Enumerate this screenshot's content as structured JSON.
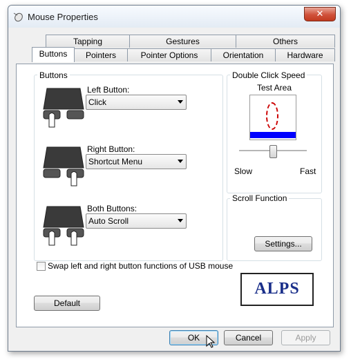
{
  "window": {
    "title": "Mouse Properties",
    "close_label": "✕"
  },
  "tabs_row1": [
    "Tapping",
    "Gestures",
    "Others"
  ],
  "tabs_row2": [
    "Buttons",
    "Pointers",
    "Pointer Options",
    "Orientation",
    "Hardware"
  ],
  "active_tab": "Buttons",
  "buttons_group": {
    "label": "Buttons",
    "left": {
      "label": "Left Button:",
      "value": "Click"
    },
    "right": {
      "label": "Right Button:",
      "value": "Shortcut Menu"
    },
    "both": {
      "label": "Both Buttons:",
      "value": "Auto Scroll"
    }
  },
  "double_click": {
    "label": "Double Click Speed",
    "test_area": "Test Area",
    "slow": "Slow",
    "fast": "Fast",
    "speed_level": 0.5
  },
  "scroll": {
    "label": "Scroll Function",
    "settings_label": "Settings..."
  },
  "swap": {
    "label": "Swap left and right button functions of USB mouse",
    "checked": false
  },
  "default_label": "Default",
  "logo_text": "ALPS",
  "footer": {
    "ok": "OK",
    "cancel": "Cancel",
    "apply": "Apply"
  },
  "colors": {
    "logo_blue": "#1a2f8a",
    "test_area_blue": "#0000ff",
    "test_area_oval": "#cc0000"
  }
}
